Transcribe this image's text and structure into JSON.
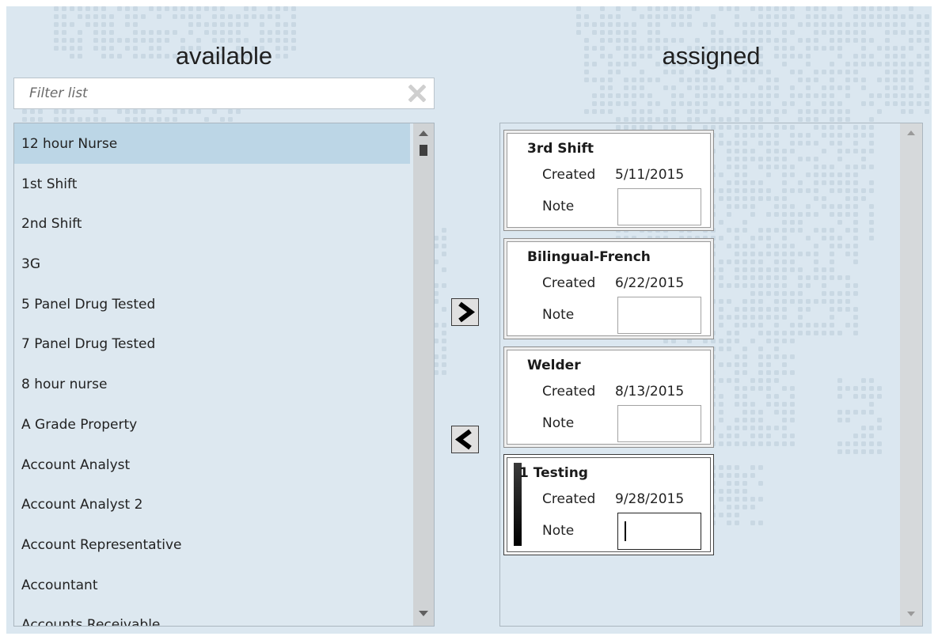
{
  "available": {
    "title": "available",
    "filter_placeholder": "Filter list",
    "items": [
      {
        "label": "12 hour Nurse",
        "selected": true
      },
      {
        "label": "1st Shift",
        "selected": false
      },
      {
        "label": "2nd Shift",
        "selected": false
      },
      {
        "label": "3G",
        "selected": false
      },
      {
        "label": "5 Panel Drug Tested",
        "selected": false
      },
      {
        "label": "7 Panel Drug Tested",
        "selected": false
      },
      {
        "label": "8 hour nurse",
        "selected": false
      },
      {
        "label": "A Grade Property",
        "selected": false
      },
      {
        "label": "Account Analyst",
        "selected": false
      },
      {
        "label": "Account Analyst 2",
        "selected": false
      },
      {
        "label": "Account Representative",
        "selected": false
      },
      {
        "label": "Accountant",
        "selected": false
      },
      {
        "label": "Accounts Receivable",
        "selected": false
      }
    ]
  },
  "assigned": {
    "title": "assigned",
    "cards": [
      {
        "name": "3rd Shift",
        "created_label": "Created",
        "created": "5/11/2015",
        "note_label": "Note",
        "note": ""
      },
      {
        "name": "Bilingual-French",
        "created_label": "Created",
        "created": "6/22/2015",
        "note_label": "Note",
        "note": ""
      },
      {
        "name": "Welder",
        "created_label": "Created",
        "created": "8/13/2015",
        "note_label": "Note",
        "note": ""
      },
      {
        "name": "1 Testing",
        "created_label": "Created",
        "created": "9/28/2015",
        "note_label": "Note",
        "note": ""
      }
    ]
  },
  "icons": {
    "clear": "close-icon",
    "move_right": "chevron-right-icon",
    "move_left": "chevron-left-icon",
    "scroll_up": "arrow-up-icon",
    "scroll_down": "arrow-down-icon"
  },
  "colors": {
    "background": "#dbe7f0",
    "selected_row": "#bcd6e6",
    "scrollbar": "#d0d3d5"
  }
}
